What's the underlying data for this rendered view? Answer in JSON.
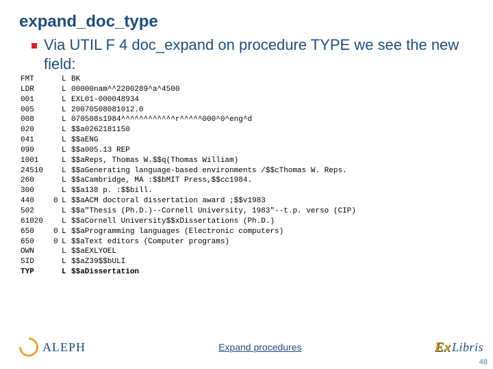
{
  "title": "expand_doc_type",
  "bullet": "Via UTIL F 4 doc_expand on procedure TYPE we see the new field:",
  "rows": [
    {
      "tag": "FMT",
      "ind": "",
      "code": "L",
      "val": "BK",
      "bold": false
    },
    {
      "tag": "LDR",
      "ind": "",
      "code": "L",
      "val": "00000nam^^2200289^a^4500",
      "bold": false
    },
    {
      "tag": "001",
      "ind": "",
      "code": "L",
      "val": "EXL01-000048934",
      "bold": false
    },
    {
      "tag": "005",
      "ind": "",
      "code": "L",
      "val": "20070508081012.0",
      "bold": false
    },
    {
      "tag": "008",
      "ind": "",
      "code": "L",
      "val": "070508s1984^^^^^^^^^^^^r^^^^^000^0^eng^d",
      "bold": false
    },
    {
      "tag": "020",
      "ind": "",
      "code": "L",
      "val": "$$a0262181150",
      "bold": false
    },
    {
      "tag": "041",
      "ind": "",
      "code": "L",
      "val": "$$aENG",
      "bold": false
    },
    {
      "tag": "090",
      "ind": "",
      "code": "L",
      "val": "$$a005.13 REP",
      "bold": false
    },
    {
      "tag": "1001",
      "ind": "",
      "code": "L",
      "val": "$$aReps, Thomas W.$$q(Thomas William)",
      "bold": false
    },
    {
      "tag": "24510",
      "ind": "",
      "code": "L",
      "val": "$$aGenerating language-based environments /$$cThomas W. Reps.",
      "bold": false
    },
    {
      "tag": "260",
      "ind": "",
      "code": "L",
      "val": "$$aCambridge, MA :$$bMIT Press,$$cc1984.",
      "bold": false
    },
    {
      "tag": "300",
      "ind": "",
      "code": "L",
      "val": "$$a138 p. :$$bill.",
      "bold": false
    },
    {
      "tag": "440",
      "ind": "0",
      "code": "L",
      "val": "$$aACM doctoral dissertation award ;$$v1983",
      "bold": false
    },
    {
      "tag": "502",
      "ind": "",
      "code": "L",
      "val": "$$a\"Thesis (Ph.D.)--Cornell University, 1983\"--t.p. verso (CIP)",
      "bold": false
    },
    {
      "tag": "61020",
      "ind": "",
      "code": "L",
      "val": "$$aCornell University$$xDissertations (Ph.D.)",
      "bold": false
    },
    {
      "tag": "650",
      "ind": "0",
      "code": "L",
      "val": "$$aProgramming languages (Electronic computers)",
      "bold": false
    },
    {
      "tag": "650",
      "ind": "0",
      "code": "L",
      "val": "$$aText editors (Computer programs)",
      "bold": false
    },
    {
      "tag": "OWN",
      "ind": "",
      "code": "L",
      "val": "$$aEXLYOEL",
      "bold": false
    },
    {
      "tag": "SID",
      "ind": "",
      "code": "L",
      "val": "$$aZ39$$bULI",
      "bold": false
    },
    {
      "tag": "TYP",
      "ind": "",
      "code": "L",
      "val": "$$aDissertation",
      "bold": true
    }
  ],
  "footer": {
    "aleph": "ALEPH",
    "center": "Expand procedures",
    "ex": "Ex",
    "libris": "Libris"
  },
  "page_number": "48"
}
